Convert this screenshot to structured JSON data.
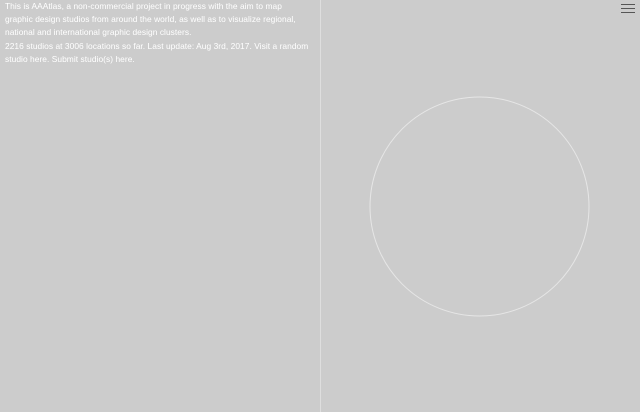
{
  "intro": {
    "line1_prefix": "This is ",
    "brand": "AAAtlas",
    "line1_rest": ", a non-commercial project in progress with the aim to map graphic design studios from around the world, as well as to visualize regio­nal, national and international graphic design clusters.",
    "stats": "2216 studios at 3006 locations so far. Last update: Aug 3rd, 2017. Visit a ",
    "random_link": "random studio here",
    "mid": ". Submit ",
    "submit_link": "studio(s) here",
    "end": "."
  },
  "menu": {
    "icon": "hamburger-menu-icon"
  },
  "colors": {
    "background": "#cccccc",
    "text": "#ffffff",
    "divider": "#dedede",
    "globe_stroke": "#e6e6e6",
    "menu_icon": "#555555"
  }
}
